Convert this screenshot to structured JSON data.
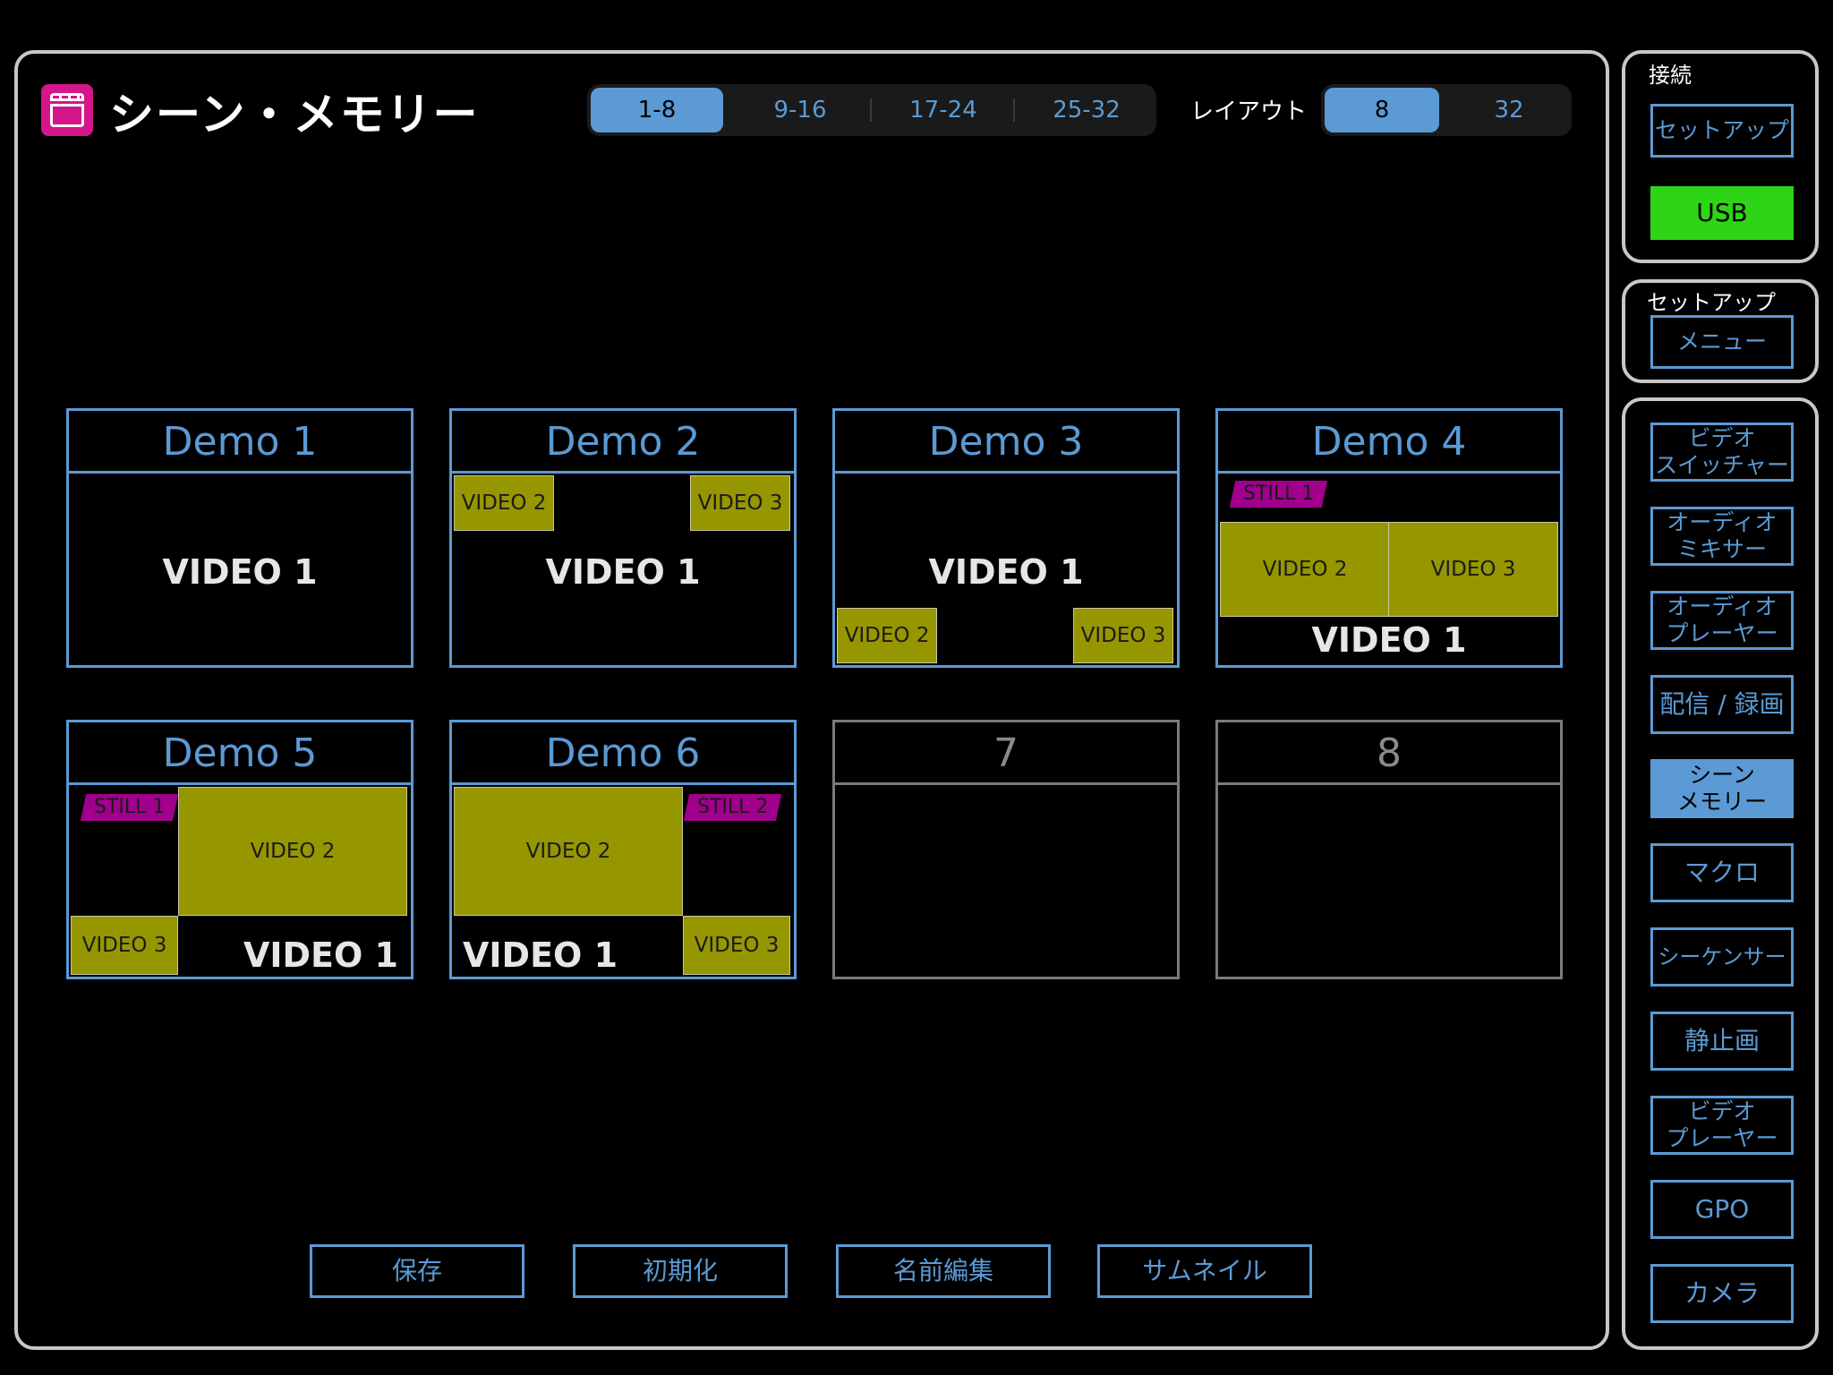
{
  "header": {
    "title": "シーン・メモリー"
  },
  "bank_tabs": [
    {
      "label": "1-8",
      "active": true
    },
    {
      "label": "9-16",
      "active": false
    },
    {
      "label": "17-24",
      "active": false
    },
    {
      "label": "25-32",
      "active": false
    }
  ],
  "layout": {
    "label": "レイアウト",
    "options": [
      {
        "label": "8",
        "active": true
      },
      {
        "label": "32",
        "active": false
      }
    ]
  },
  "scenes": [
    {
      "name": "Demo 1",
      "main": "VIDEO 1"
    },
    {
      "name": "Demo 2",
      "main": "VIDEO 1",
      "sub1": "VIDEO 2",
      "sub2": "VIDEO 3"
    },
    {
      "name": "Demo 3",
      "main": "VIDEO 1",
      "sub1": "VIDEO 2",
      "sub2": "VIDEO 3"
    },
    {
      "name": "Demo 4",
      "main": "VIDEO 1",
      "sub1": "VIDEO 2",
      "sub2": "VIDEO 3",
      "still": "STILL 1"
    },
    {
      "name": "Demo 5",
      "main": "VIDEO 1",
      "sub1": "VIDEO 2",
      "sub2": "VIDEO 3",
      "still": "STILL 1"
    },
    {
      "name": "Demo 6",
      "main": "VIDEO 1",
      "sub1": "VIDEO 2",
      "sub2": "VIDEO 3",
      "still": "STILL 2"
    },
    {
      "name": "7"
    },
    {
      "name": "8"
    }
  ],
  "actions": {
    "save": "保存",
    "init": "初期化",
    "rename": "名前編集",
    "thumbnail": "サムネイル"
  },
  "connection": {
    "label": "接続",
    "setup_button": "セットアップ",
    "usb_status": "USB",
    "usb_color": "#2ed416"
  },
  "setup": {
    "label": "セットアップ",
    "menu_button": "メニュー"
  },
  "sidebar": {
    "video_switcher": [
      "ビデオ",
      "スイッチャー"
    ],
    "audio_mixer": [
      "オーディオ",
      "ミキサー"
    ],
    "audio_player": [
      "オーディオ",
      "プレーヤー"
    ],
    "stream_record": "配信 / 録画",
    "scene_memory": [
      "シーン",
      "メモリー"
    ],
    "macro": "マクロ",
    "sequencer": "シーケンサー",
    "still_image": "静止画",
    "video_player": [
      "ビデオ",
      "プレーヤー"
    ],
    "gpo": "GPO",
    "camera": "カメラ"
  },
  "colors": {
    "accent": "#5b9ad4",
    "video_box": "#969600",
    "still_tag": "#a0008c",
    "title_icon": "#d4168a"
  }
}
